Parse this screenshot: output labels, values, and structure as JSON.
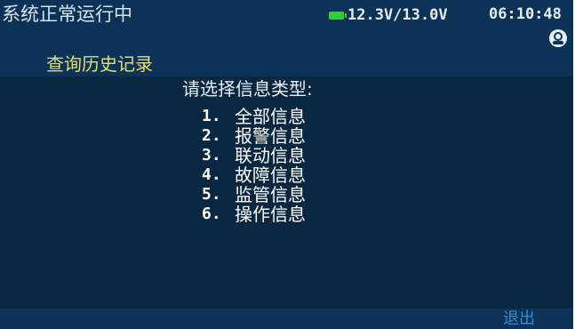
{
  "status": {
    "system_state": "系统正常运行中",
    "battery_icon": "battery-icon",
    "voltage": "12.3V/13.0V",
    "time": "06:10:48",
    "user_icon": "user-icon"
  },
  "title": "查询历史记录",
  "prompt": "请选择信息类型:",
  "menu": [
    {
      "num": "1.",
      "label": "全部信息"
    },
    {
      "num": "2.",
      "label": "报警信息"
    },
    {
      "num": "3.",
      "label": "联动信息"
    },
    {
      "num": "4.",
      "label": "故障信息"
    },
    {
      "num": "5.",
      "label": "监管信息"
    },
    {
      "num": "6.",
      "label": "操作信息"
    }
  ],
  "footer": {
    "exit_label": "退出"
  },
  "colors": {
    "background": "#0a2742",
    "bar": "#0c3257",
    "title": "#e2df6c",
    "battery": "#2fd12f",
    "exit": "#2f8fd8"
  }
}
